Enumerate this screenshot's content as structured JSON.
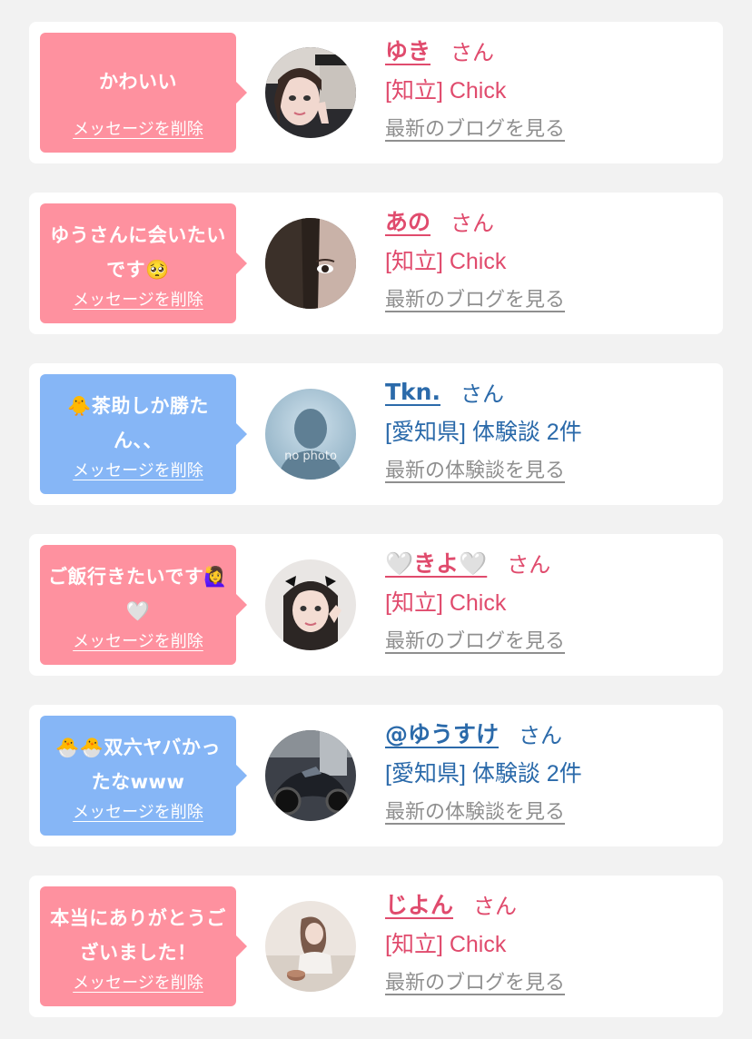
{
  "delete_label": "メッセージを削除",
  "honorific": "さん",
  "colors": {
    "girl_bubble": "#fe919f",
    "customer_bubble": "#86b6f6",
    "girl_text": "#e04b6d",
    "customer_text": "#2b6aaa",
    "link_text": "#8f8f8f"
  },
  "messages": [
    {
      "theme": "pink",
      "message": "かわいい",
      "name": "ゆき",
      "area_info": "[知立] Chick",
      "link": "最新のブログを見る",
      "avatar_icon": "girl-photo-avatar"
    },
    {
      "theme": "pink",
      "message": "ゆうさんに会いたいです🥺",
      "name": "あの",
      "area_info": "[知立] Chick",
      "link": "最新のブログを見る",
      "avatar_icon": "girl-photo-avatar"
    },
    {
      "theme": "blue",
      "message": "🐥茶助しか勝たん、、",
      "name": "Tkn.",
      "area_info": "[愛知県] 体験談 2件",
      "link": "最新の体験談を見る",
      "avatar_icon": "no-photo-avatar",
      "avatar_text": "no photo"
    },
    {
      "theme": "pink",
      "message": "ご飯行きたいです🙋‍♀️🤍",
      "name": "🤍きよ🤍",
      "area_info": "[知立] Chick",
      "link": "最新のブログを見る",
      "avatar_icon": "girl-photo-avatar"
    },
    {
      "theme": "blue",
      "message": "🐣🐣双六ヤバかったなwww",
      "name": "@ゆうすけ",
      "area_info": "[愛知県] 体験談 2件",
      "link": "最新の体験談を見る",
      "avatar_icon": "motorcycle-photo-avatar"
    },
    {
      "theme": "pink",
      "message": "本当にありがとうございました！",
      "name": "じよん",
      "area_info": "[知立] Chick",
      "link": "最新のブログを見る",
      "avatar_icon": "girl-photo-avatar"
    }
  ]
}
